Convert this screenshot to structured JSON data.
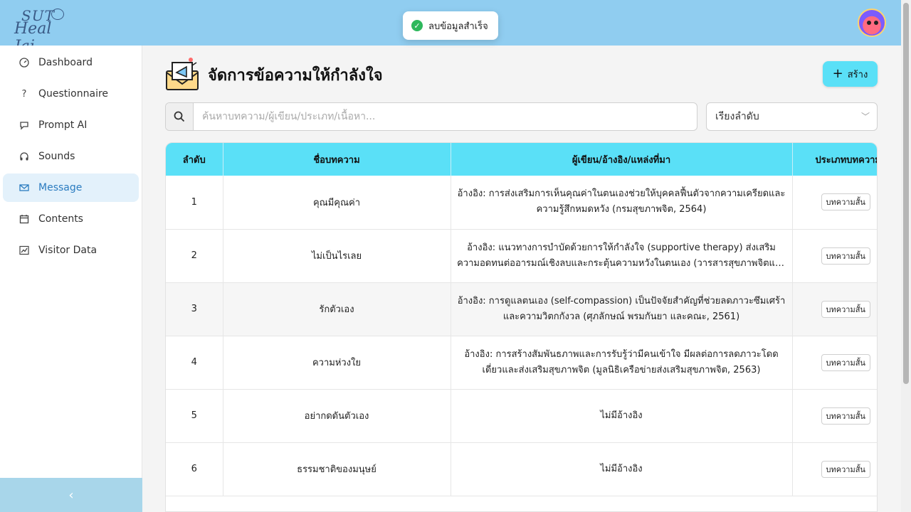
{
  "header": {
    "logo_line1": "SUT",
    "logo_line2": "Heal Jai",
    "avatar": "user-avatar"
  },
  "toast": {
    "message": "ลบข้อมูลสำเร็จ",
    "icon": "check-circle-icon"
  },
  "sidebar": {
    "items": [
      {
        "label": "Dashboard",
        "icon": "dashboard-gauge-icon"
      },
      {
        "label": "Questionnaire",
        "icon": "question-icon"
      },
      {
        "label": "Prompt AI",
        "icon": "chat-bubble-icon"
      },
      {
        "label": "Sounds",
        "icon": "headphones-icon"
      },
      {
        "label": "Message",
        "icon": "mail-icon",
        "active": true
      },
      {
        "label": "Contents",
        "icon": "calendar-icon"
      },
      {
        "label": "Visitor Data",
        "icon": "line-chart-icon"
      }
    ],
    "collapse_icon": "chevron-left-icon"
  },
  "main": {
    "title": "จัดการข้อความให้กำลังใจ",
    "create_label": "สร้าง",
    "search_placeholder": "ค้นหาบทความ/ผู้เขียน/ประเภท/เนื้อหา...",
    "sort_label": "เรียงลำดับ"
  },
  "table": {
    "headers": [
      "ลำดับ",
      "ชื่อบทความ",
      "ผู้เขียน/อ้างอิง/แหล่งที่มา",
      "ประเภทบทความ"
    ],
    "rows": [
      {
        "no": "1",
        "title": "คุณมีคุณค่า",
        "ref": "อ้างอิง: การส่งเสริมการเห็นคุณค่าในตนเองช่วยให้บุคคลฟื้นตัวจากความเครียดและความรู้สึกหมดหวัง (กรมสุขภาพจิต, 2564)",
        "type": "บทความสั้น"
      },
      {
        "no": "2",
        "title": "ไม่เป็นไรเลย",
        "ref": "อ้างอิง: แนวทางการบำบัดด้วยการให้กำลังใจ (supportive therapy) ส่งเสริมความอดทนต่ออารมณ์เชิงลบและกระตุ้นความหวังในตนเอง (วารสารสุขภาพจิตแห่งประเทศไทย)",
        "type": "บทความสั้น"
      },
      {
        "no": "3",
        "title": "รักตัวเอง",
        "ref": "อ้างอิง: การดูแลตนเอง (self-compassion) เป็นปัจจัยสำคัญที่ช่วยลดภาวะซึมเศร้าและความวิตกกังวล (ศุภลักษณ์ พรมกันยา และคณะ, 2561)",
        "type": "บทความสั้น"
      },
      {
        "no": "4",
        "title": "ความห่วงใย",
        "ref": "อ้างอิง: การสร้างสัมพันธภาพและการรับรู้ว่ามีคนเข้าใจ มีผลต่อการลดภาวะโดดเดี่ยวและส่งเสริมสุขภาพจิต (มูลนิธิเครือข่ายส่งเสริมสุขภาพจิต, 2563)",
        "type": "บทความสั้น"
      },
      {
        "no": "5",
        "title": "อย่ากดดันตัวเอง",
        "ref": "ไม่มีอ้างอิง",
        "type": "บทความสั้น"
      },
      {
        "no": "6",
        "title": "ธรรมชาติของมนุษย์",
        "ref": "ไม่มีอ้างอิง",
        "type": "บทความสั้น"
      }
    ]
  },
  "colors": {
    "topbar": "#90cdf0",
    "accent": "#5ae0f7",
    "active_nav_bg": "#e3f1fb",
    "success": "#2eb85c"
  }
}
